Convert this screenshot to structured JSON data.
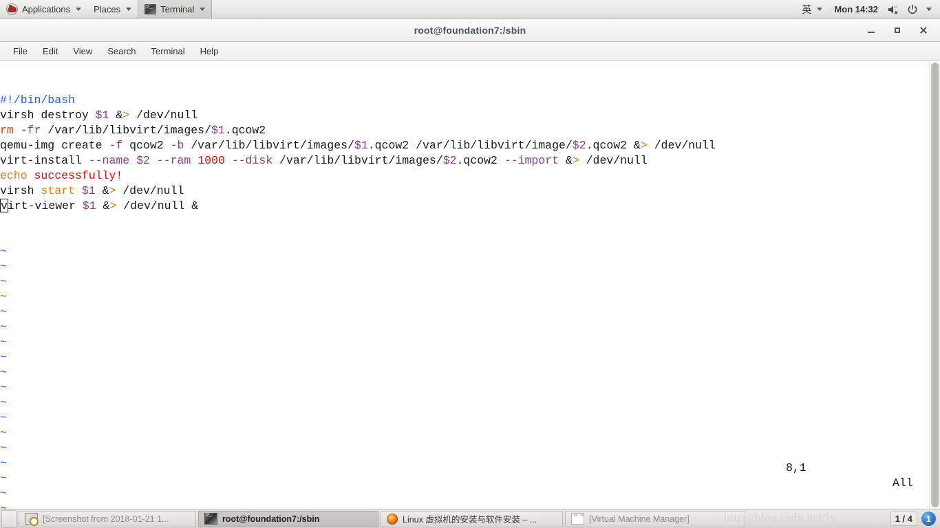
{
  "top_panel": {
    "logo_icon": "redhat-logo-icon",
    "applications_label": "Applications",
    "places_label": "Places",
    "active_window_label": "Terminal",
    "input_method_label": "英",
    "clock": "Mon 14:32",
    "volume_icon": "volume-muted-icon",
    "power_icon": "power-icon"
  },
  "window": {
    "title": "root@foundation7:/sbin",
    "minimize_label": "−",
    "maximize_label": "□",
    "close_label": "×",
    "menus": [
      "File",
      "Edit",
      "View",
      "Search",
      "Terminal",
      "Help"
    ]
  },
  "terminal": {
    "lines": [
      [
        {
          "t": "#!/bin/bash",
          "c": "c-blue"
        }
      ],
      [
        {
          "t": "virsh destroy ",
          "c": "c-plain"
        },
        {
          "t": "$1",
          "c": "c-purple"
        },
        {
          "t": " ",
          "c": "c-plain"
        },
        {
          "t": "&",
          "c": "c-plain"
        },
        {
          "t": ">",
          "c": "c-orange"
        },
        {
          "t": " /dev/null",
          "c": "c-plain"
        }
      ],
      [
        {
          "t": "rm ",
          "c": "c-rust"
        },
        {
          "t": "-fr",
          "c": "c-purple"
        },
        {
          "t": " /var/lib/libvirt/images/",
          "c": "c-plain"
        },
        {
          "t": "$1",
          "c": "c-purple"
        },
        {
          "t": ".qcow2",
          "c": "c-plain"
        }
      ],
      [
        {
          "t": "qemu-img create ",
          "c": "c-plain"
        },
        {
          "t": "-f",
          "c": "c-purple"
        },
        {
          "t": " qcow2 ",
          "c": "c-plain"
        },
        {
          "t": "-b",
          "c": "c-purple"
        },
        {
          "t": " /var/lib/libvirt/images/",
          "c": "c-plain"
        },
        {
          "t": "$1",
          "c": "c-purple"
        },
        {
          "t": ".qcow2 /var/lib/libvirt/image/",
          "c": "c-plain"
        },
        {
          "t": "$2",
          "c": "c-purple"
        },
        {
          "t": ".qcow2 ",
          "c": "c-plain"
        },
        {
          "t": "&",
          "c": "c-plain"
        },
        {
          "t": ">",
          "c": "c-orange"
        },
        {
          "t": " /dev/null",
          "c": "c-plain"
        }
      ],
      [
        {
          "t": "virt-install ",
          "c": "c-plain"
        },
        {
          "t": "--name",
          "c": "c-purple"
        },
        {
          "t": " ",
          "c": "c-plain"
        },
        {
          "t": "$2",
          "c": "c-purple"
        },
        {
          "t": " ",
          "c": "c-plain"
        },
        {
          "t": "--ram",
          "c": "c-purple"
        },
        {
          "t": " ",
          "c": "c-plain"
        },
        {
          "t": "1000",
          "c": "c-red"
        },
        {
          "t": " ",
          "c": "c-plain"
        },
        {
          "t": "--disk",
          "c": "c-purple"
        },
        {
          "t": " /var/lib/libvirt/images/",
          "c": "c-plain"
        },
        {
          "t": "$2",
          "c": "c-purple"
        },
        {
          "t": ".qcow2 ",
          "c": "c-plain"
        },
        {
          "t": "--import",
          "c": "c-purple"
        },
        {
          "t": " ",
          "c": "c-plain"
        },
        {
          "t": "&",
          "c": "c-plain"
        },
        {
          "t": ">",
          "c": "c-orange"
        },
        {
          "t": " /dev/null",
          "c": "c-plain"
        }
      ],
      [
        {
          "t": "echo ",
          "c": "c-orange"
        },
        {
          "t": "successfully!",
          "c": "c-red"
        }
      ],
      [
        {
          "t": "virsh ",
          "c": "c-plain"
        },
        {
          "t": "start",
          "c": "c-orange"
        },
        {
          "t": " ",
          "c": "c-plain"
        },
        {
          "t": "$1",
          "c": "c-purple"
        },
        {
          "t": " ",
          "c": "c-plain"
        },
        {
          "t": "&",
          "c": "c-plain"
        },
        {
          "t": ">",
          "c": "c-orange"
        },
        {
          "t": " /dev/null",
          "c": "c-plain"
        }
      ],
      [
        {
          "t": "v",
          "c": "c-plain",
          "cursor": true
        },
        {
          "t": "irt-viewer ",
          "c": "c-plain"
        },
        {
          "t": "$1",
          "c": "c-purple"
        },
        {
          "t": " ",
          "c": "c-plain"
        },
        {
          "t": "&",
          "c": "c-plain"
        },
        {
          "t": ">",
          "c": "c-orange"
        },
        {
          "t": " /dev/null &",
          "c": "c-plain"
        }
      ]
    ],
    "empty_marker": "~",
    "empty_marker_count": 19,
    "status_position": "8,1",
    "status_scroll": "All"
  },
  "taskbar": {
    "tasks": [
      {
        "label": "[Screenshot from 2018-01-21 1...",
        "icon": "screenshot-icon",
        "state": "dim"
      },
      {
        "label": "root@foundation7:/sbin",
        "icon": "terminal-icon",
        "state": "focused"
      },
      {
        "label": "Linux 虚拟机的安装与软件安装 – ...",
        "icon": "firefox-icon",
        "state": "normal"
      },
      {
        "label": "[Virtual Machine Manager]",
        "icon": "virtmanager-icon",
        "state": "dim"
      }
    ],
    "watermark": "http://blog.csdn.net/ly",
    "workspace": "1 / 4",
    "notification_count": "1"
  }
}
